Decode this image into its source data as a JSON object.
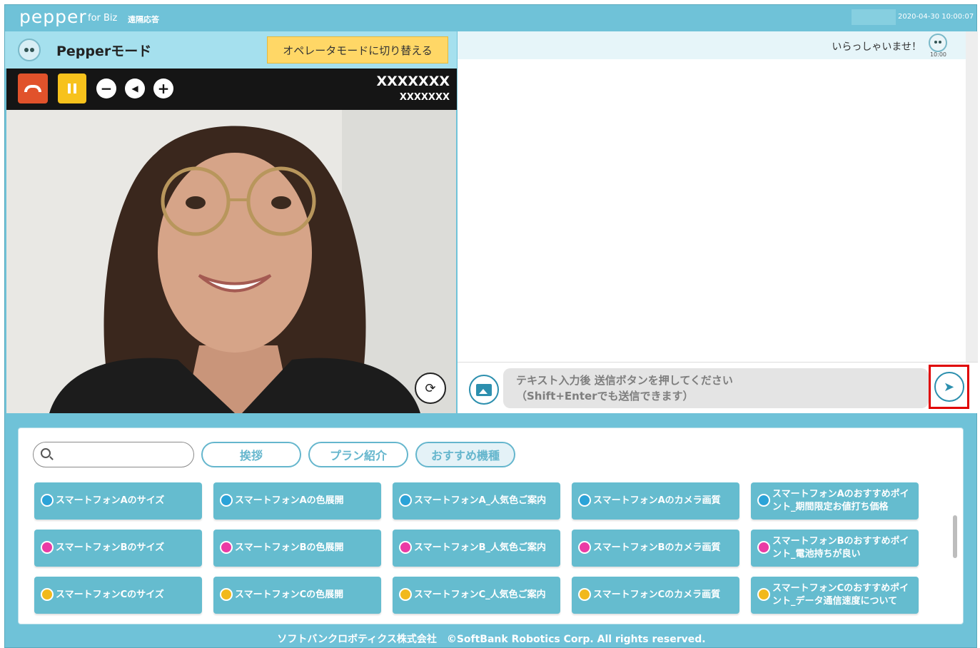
{
  "topbar": {
    "logo": "pepper",
    "logo_suffix": "for Biz",
    "app_name": "遠隔応答",
    "datetime": "2020-04-30  10:00:07"
  },
  "mode_header": {
    "title": "Pepperモード",
    "switch_button": "オペレータモードに切り替える"
  },
  "controls": {
    "minus": "−",
    "volume": "◀",
    "plus": "+",
    "caller_name": "XXXXXXX",
    "caller_sub": "XXXXXXX"
  },
  "chat": {
    "greeting": "いらっしゃいませ！",
    "greeting_time": "10:00",
    "input_placeholder": "テキスト入力後 送信ボタンを押してください\n（Shift+Enterでも送信できます）",
    "send_icon": "➤"
  },
  "search": {
    "placeholder": ""
  },
  "categories": [
    "挨拶",
    "プラン紹介",
    "おすすめ機種"
  ],
  "quick_rows": [
    {
      "color": "#2ba3d8",
      "items": [
        "スマートフォンAのサイズ",
        "スマートフォンAの色展開",
        "スマートフォンA_人気色ご案内",
        "スマートフォンAのカメラ画質",
        "スマートフォンAのおすすめポイント_期間限定お値打ち価格"
      ]
    },
    {
      "color": "#ea3ba5",
      "items": [
        "スマートフォンBのサイズ",
        "スマートフォンBの色展開",
        "スマートフォンB_人気色ご案内",
        "スマートフォンBのカメラ画質",
        "スマートフォンBのおすすめポイント_電池持ちが良い"
      ]
    },
    {
      "color": "#f1b91c",
      "items": [
        "スマートフォンCのサイズ",
        "スマートフォンCの色展開",
        "スマートフォンC_人気色ご案内",
        "スマートフォンCのカメラ画質",
        "スマートフォンCのおすすめポイント_データ通信速度について"
      ]
    }
  ],
  "footer": "ソフトバンクロボティクス株式会社　©SoftBank Robotics Corp. All rights reserved."
}
